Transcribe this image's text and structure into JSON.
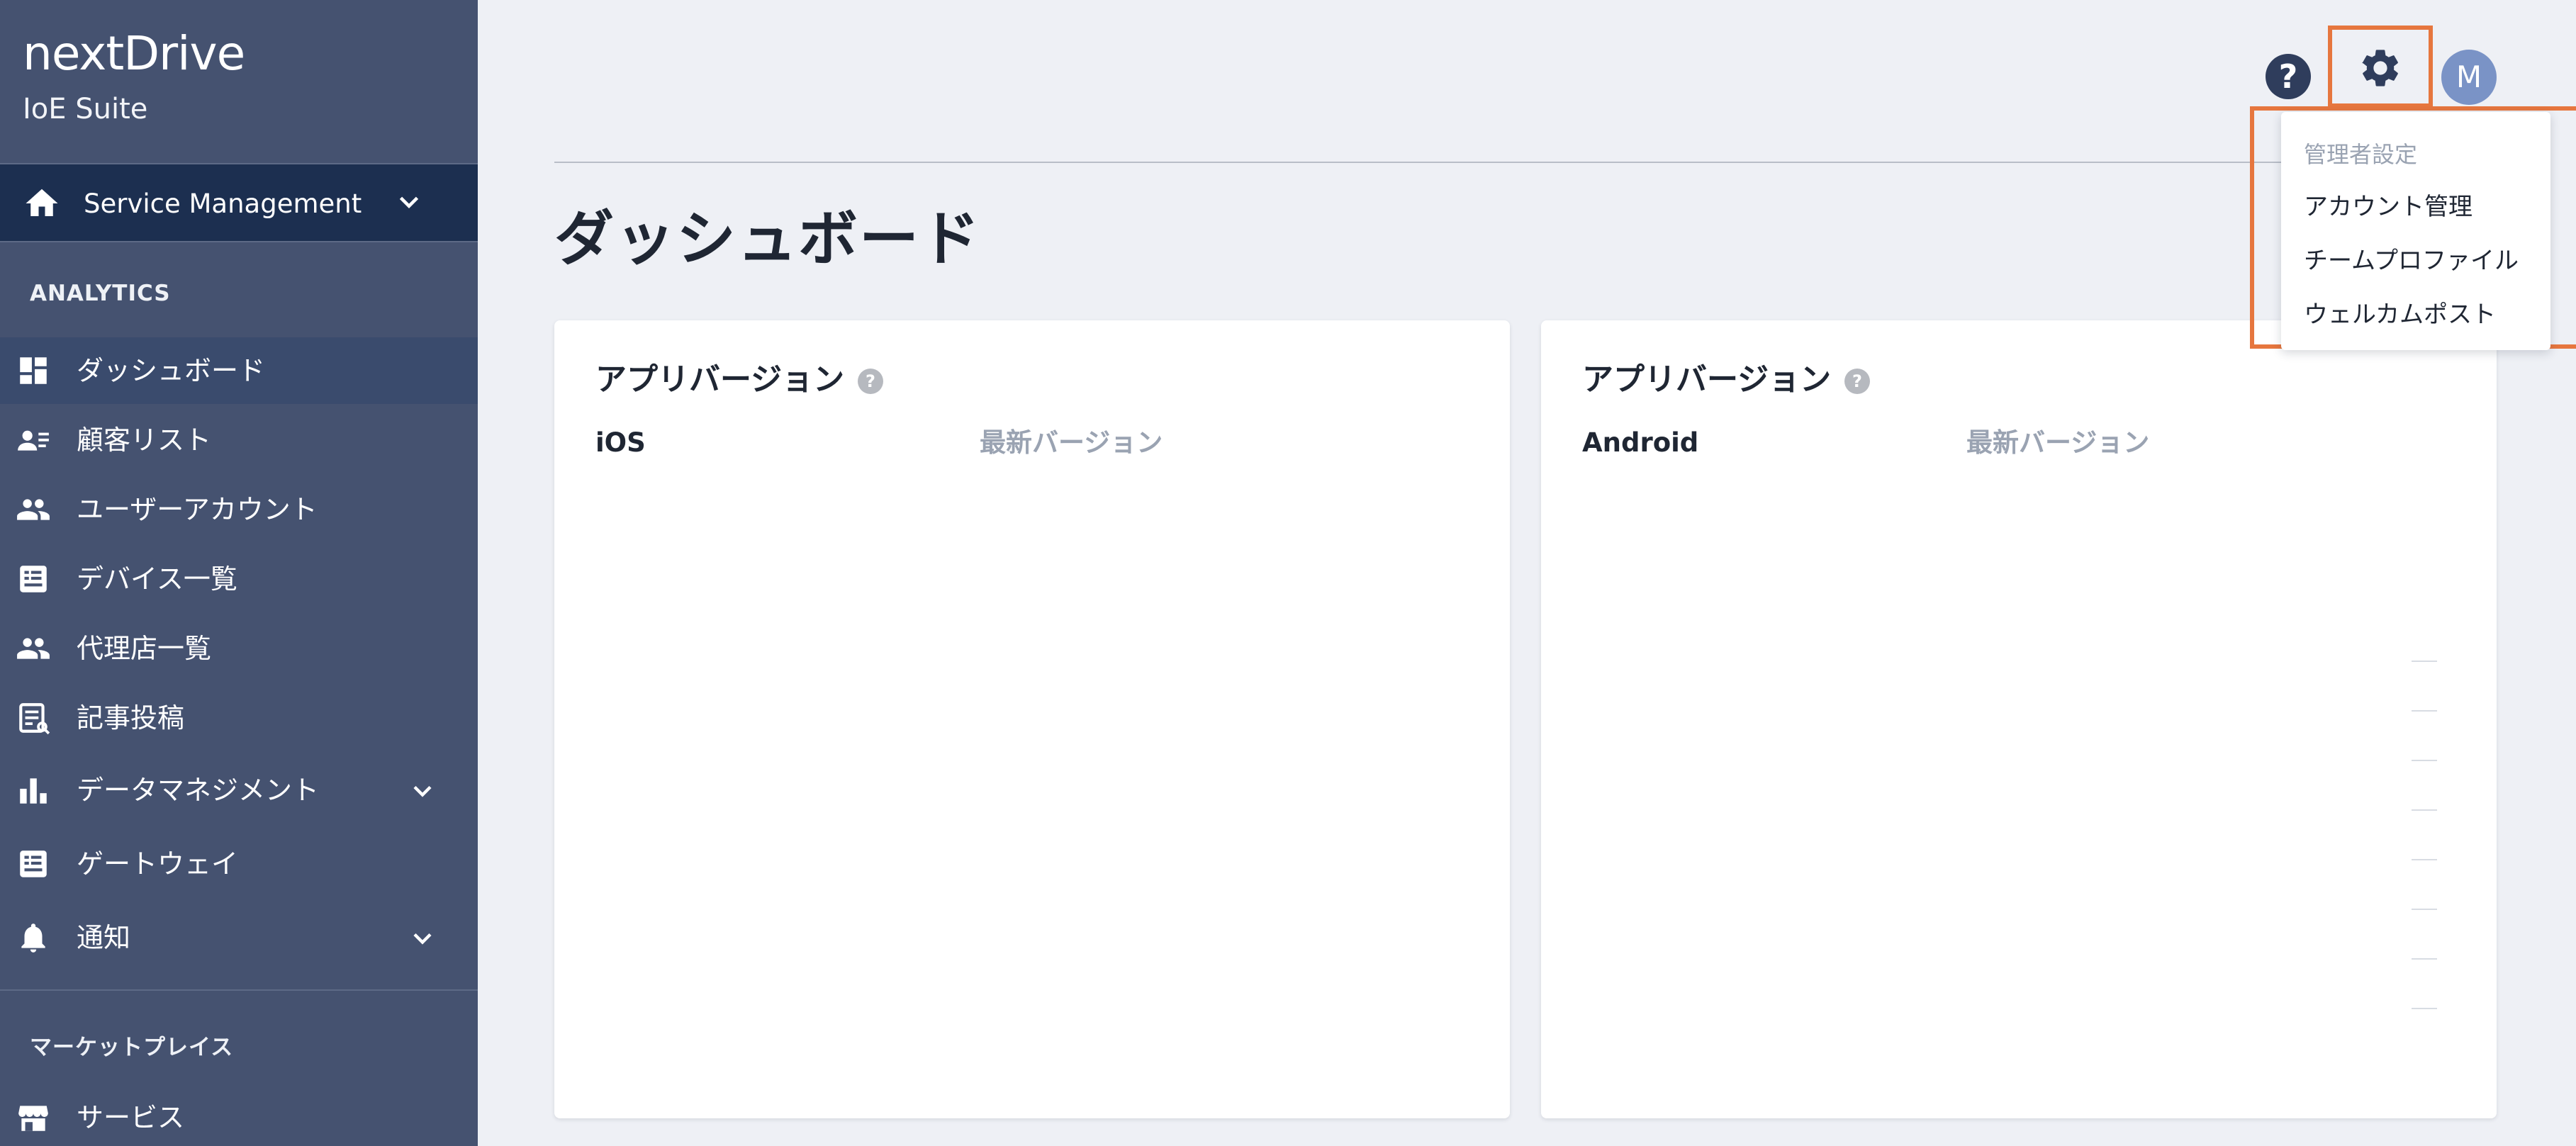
{
  "brand": {
    "logo": "nextDrive",
    "subtitle": "IoE Suite"
  },
  "service_selector": {
    "label": "Service Management"
  },
  "sidebar": {
    "section_analytics": "ANALYTICS",
    "items": [
      {
        "label": "ダッシュボード",
        "icon": "dashboard-icon"
      },
      {
        "label": "顧客リスト",
        "icon": "customer-list-icon"
      },
      {
        "label": "ユーザーアカウント",
        "icon": "users-icon"
      },
      {
        "label": "デバイス一覧",
        "icon": "device-icon"
      },
      {
        "label": "代理店一覧",
        "icon": "agency-icon"
      },
      {
        "label": "記事投稿",
        "icon": "article-icon"
      },
      {
        "label": "データマネジメント",
        "icon": "bar-chart-icon"
      },
      {
        "label": "ゲートウェイ",
        "icon": "gateway-icon"
      },
      {
        "label": "通知",
        "icon": "bell-icon"
      }
    ],
    "section_marketplace": "マーケットプレイス",
    "marketplace_items": [
      {
        "label": "サービス",
        "icon": "store-icon"
      }
    ]
  },
  "header": {
    "help_glyph": "?",
    "avatar_initial": "M"
  },
  "page": {
    "title": "ダッシュボード"
  },
  "cards": [
    {
      "title": "アプリバージョン",
      "platform": "iOS",
      "latest_label": "最新バージョン"
    },
    {
      "title": "アプリバージョン",
      "platform": "Android",
      "latest_label": "最新バージョン"
    }
  ],
  "settings_menu": {
    "header": "管理者設定",
    "items": [
      "アカウント管理",
      "チームプロファイル",
      "ウェルカムポスト"
    ]
  },
  "colors": {
    "sidebar_bg": "#455270",
    "sidebar_active": "#3a4b6d",
    "service_bg": "#1c2f50",
    "highlight_outline": "#e6763e",
    "page_bg": "#eef0f5"
  }
}
